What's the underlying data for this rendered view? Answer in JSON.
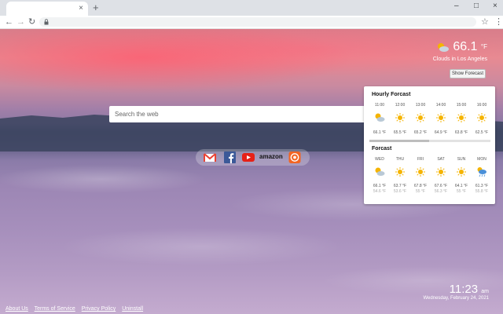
{
  "browser": {
    "tab_close": "×",
    "new_tab": "+",
    "minimize": "–",
    "maximize": "□",
    "close": "×",
    "back": "←",
    "forward": "→",
    "reload": "↻",
    "star": "☆",
    "menu": "⋮"
  },
  "weather": {
    "temp": "66.1",
    "unit": "°F",
    "desc": "Clouds in Los Angeles",
    "show_btn": "Show Forecast"
  },
  "search": {
    "placeholder": "Search the web"
  },
  "shortcuts": [
    "gmail-icon",
    "facebook-icon",
    "youtube-icon",
    "amazon",
    "shortcut-app-icon"
  ],
  "shortcuts_text": {
    "amazon": "amazon"
  },
  "hourly": {
    "title": "Hourly Forcast",
    "times": [
      "11:00",
      "12:00",
      "13:00",
      "14:00",
      "15:00",
      "16:00"
    ],
    "icons": [
      "partly-cloudy-icon",
      "sun-icon",
      "sun-icon",
      "sun-icon",
      "sun-icon",
      "sun-icon"
    ],
    "temps": [
      "66.1 °F",
      "65.5 °F",
      "65.2 °F",
      "64.9 °F",
      "63.8 °F",
      "62.5 °F"
    ]
  },
  "daily": {
    "title": "Forcast",
    "days": [
      "WED",
      "THU",
      "FRI",
      "SAT",
      "SUN",
      "MON"
    ],
    "icons": [
      "partly-cloudy-icon",
      "sun-icon",
      "sun-icon",
      "sun-icon",
      "sun-icon",
      "rain-cloud-icon"
    ],
    "highs": [
      "66.1 °F",
      "63.7 °F",
      "67.8 °F",
      "67.6 °F",
      "64.1 °F",
      "61.3 °F"
    ],
    "lows": [
      "54.6 °F",
      "53.6 °F",
      "55 °F",
      "56.3 °F",
      "55 °F",
      "55.8 °F"
    ]
  },
  "clock": {
    "time": "11:23",
    "ampm": "am",
    "date": "Wednesday, February 24, 2021"
  },
  "footer": [
    "About Us",
    "Terms of Service",
    "Privacy Policy",
    "Uninstall"
  ],
  "colors": {
    "sun": "#f5b400",
    "cloud": "#b9c9d6",
    "accent": "#4a90d9"
  }
}
